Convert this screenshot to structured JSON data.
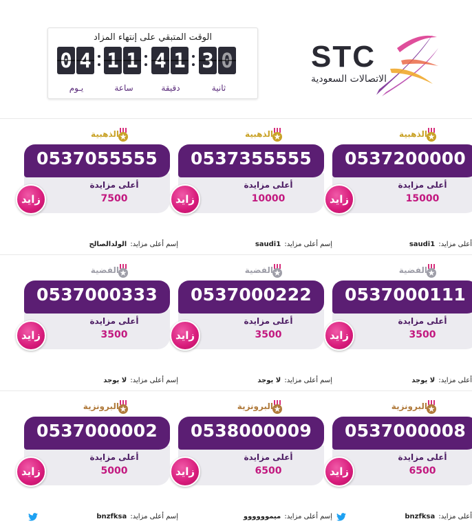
{
  "countdown": {
    "title": "الوقت المتبقي على إنتهاء المزاد",
    "digits": [
      "0",
      "4",
      "1",
      "1",
      "4",
      "1",
      "3",
      "0"
    ],
    "labels": {
      "days": "يـوم",
      "hours": "ساعة",
      "minutes": "دقيقة",
      "seconds": "ثانية"
    }
  },
  "logo": {
    "wordmark": "STC",
    "arabic": "الاتصالات السعودية",
    "colors": [
      "#7a2d96",
      "#d92f8a",
      "#f0a82d"
    ]
  },
  "labels": {
    "highest_bid": "أعلى مزايدة",
    "bid_button": "زايد",
    "top_bidder_prefix": "إسم أعلى مزايد:"
  },
  "tier_colors": {
    "gold": "#c9a227",
    "silver": "#9e9ea8",
    "bronze": "#b07a3b"
  },
  "cards": [
    {
      "tier": "الذهبية",
      "tier_key": "gold",
      "number": "0537200000",
      "bid": "15000",
      "bidder": "saudi1",
      "twitter": false
    },
    {
      "tier": "الذهبية",
      "tier_key": "gold",
      "number": "0537355555",
      "bid": "10000",
      "bidder": "saudi1",
      "twitter": false
    },
    {
      "tier": "الذهبية",
      "tier_key": "gold",
      "number": "0537055555",
      "bid": "7500",
      "bidder": "الولدالصالح",
      "twitter": false
    },
    {
      "tier": "الفضية",
      "tier_key": "silver",
      "number": "0537000111",
      "bid": "3500",
      "bidder": "لا يوجد",
      "twitter": false
    },
    {
      "tier": "الفضية",
      "tier_key": "silver",
      "number": "0537000222",
      "bid": "3500",
      "bidder": "لا يوجد",
      "twitter": false
    },
    {
      "tier": "الفضية",
      "tier_key": "silver",
      "number": "0537000333",
      "bid": "3500",
      "bidder": "لا يوجد",
      "twitter": false
    },
    {
      "tier": "البرونزية",
      "tier_key": "bronze",
      "number": "0537000008",
      "bid": "6500",
      "bidder": "bnzfksa",
      "twitter": true
    },
    {
      "tier": "البرونزية",
      "tier_key": "bronze",
      "number": "0538000009",
      "bid": "6500",
      "bidder": "ميموووووو",
      "twitter": false
    },
    {
      "tier": "البرونزية",
      "tier_key": "bronze",
      "number": "0537000002",
      "bid": "5000",
      "bidder": "bnzfksa",
      "twitter": true
    }
  ]
}
